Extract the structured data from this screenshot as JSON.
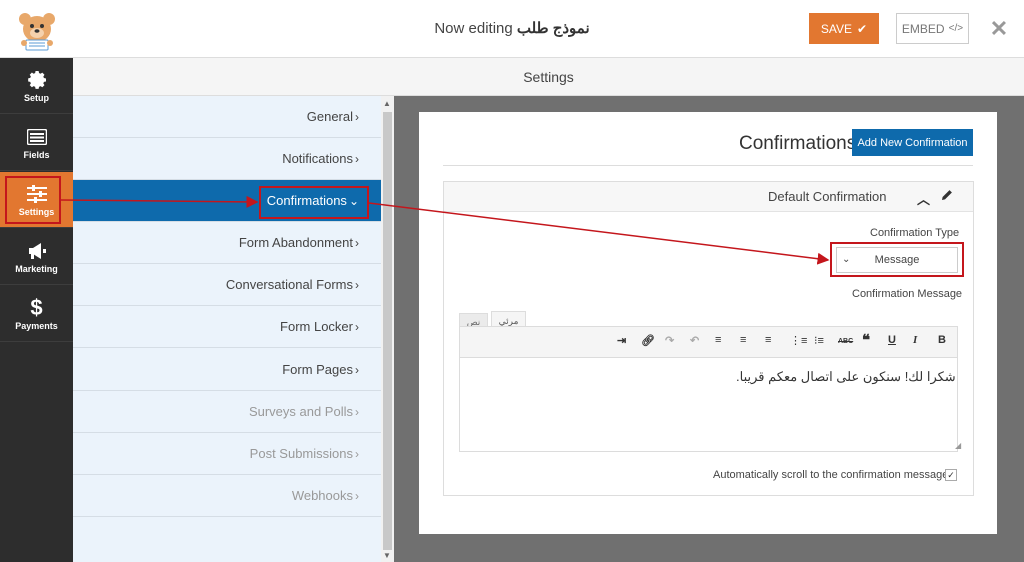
{
  "header": {
    "form_name": "نموذج طلب",
    "editing_label": "Now editing",
    "save_label": "SAVE",
    "embed_label": "EMBED"
  },
  "leftnav": {
    "items": [
      {
        "label": "Setup",
        "icon": "gear-icon"
      },
      {
        "label": "Fields",
        "icon": "list-icon"
      },
      {
        "label": "Settings",
        "icon": "sliders-icon"
      },
      {
        "label": "Marketing",
        "icon": "megaphone-icon"
      },
      {
        "label": "Payments",
        "icon": "dollar-icon"
      }
    ],
    "active": "Settings"
  },
  "settings": {
    "title": "Settings",
    "items": [
      {
        "label": "General"
      },
      {
        "label": "Notifications"
      },
      {
        "label": "Confirmations"
      },
      {
        "label": "Form Abandonment"
      },
      {
        "label": "Conversational Forms"
      },
      {
        "label": "Form Locker"
      },
      {
        "label": "Form Pages"
      },
      {
        "label": "Surveys and Polls"
      },
      {
        "label": "Post Submissions"
      },
      {
        "label": "Webhooks"
      }
    ],
    "active": "Confirmations"
  },
  "confirmations": {
    "title": "Confirmations",
    "add_button": "Add New Confirmation",
    "box_title": "Default Confirmation",
    "type_label": "Confirmation Type",
    "type_value": "Message",
    "message_label": "Confirmation Message",
    "tab_visual": "مرئي",
    "tab_text": "نص",
    "message_text": "شكرا لك! سنكون على اتصال معكم قريبا.",
    "scroll_label": "Automatically scroll to the confirmation message",
    "scroll_checked": true
  },
  "colors": {
    "accent_orange": "#e27730",
    "primary_blue": "#0e6aac",
    "annotation_red": "#c4161c",
    "nav_dark": "#2d2d2d"
  }
}
